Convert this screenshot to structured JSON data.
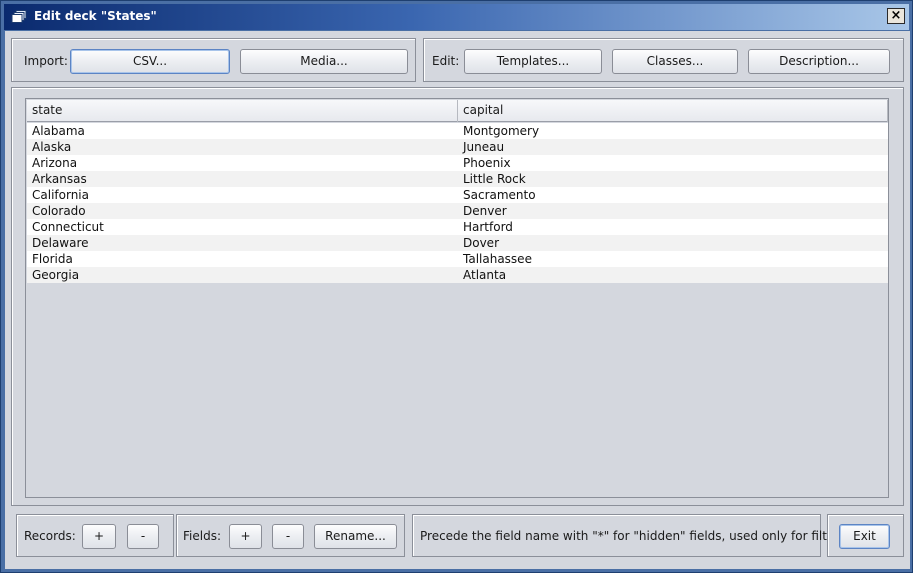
{
  "window": {
    "title": "Edit deck \"States\"",
    "close_label": "×"
  },
  "import": {
    "label": "Import:",
    "csv_label": "CSV...",
    "media_label": "Media..."
  },
  "edit": {
    "label": "Edit:",
    "templates_label": "Templates...",
    "classes_label": "Classes...",
    "description_label": "Description..."
  },
  "table": {
    "columns": [
      "state",
      "capital"
    ],
    "rows": [
      [
        "Alabama",
        "Montgomery"
      ],
      [
        "Alaska",
        "Juneau"
      ],
      [
        "Arizona",
        "Phoenix"
      ],
      [
        "Arkansas",
        "Little Rock"
      ],
      [
        "California",
        "Sacramento"
      ],
      [
        "Colorado",
        "Denver"
      ],
      [
        "Connecticut",
        "Hartford"
      ],
      [
        "Delaware",
        "Dover"
      ],
      [
        "Florida",
        "Tallahassee"
      ],
      [
        "Georgia",
        "Atlanta"
      ]
    ]
  },
  "records": {
    "label": "Records:",
    "add_label": "+",
    "remove_label": "-"
  },
  "fields": {
    "label": "Fields:",
    "add_label": "+",
    "remove_label": "-",
    "rename_label": "Rename..."
  },
  "hint": "Precede the field name with \"*\" for \"hidden\" fields, used only for filtering",
  "exit_label": "Exit",
  "colors": {
    "title_gradient_start": "#0a2a6e",
    "title_gradient_end": "#a9c7e8",
    "panel_bg": "#d4d7de",
    "frame": "#4a6fa5"
  }
}
